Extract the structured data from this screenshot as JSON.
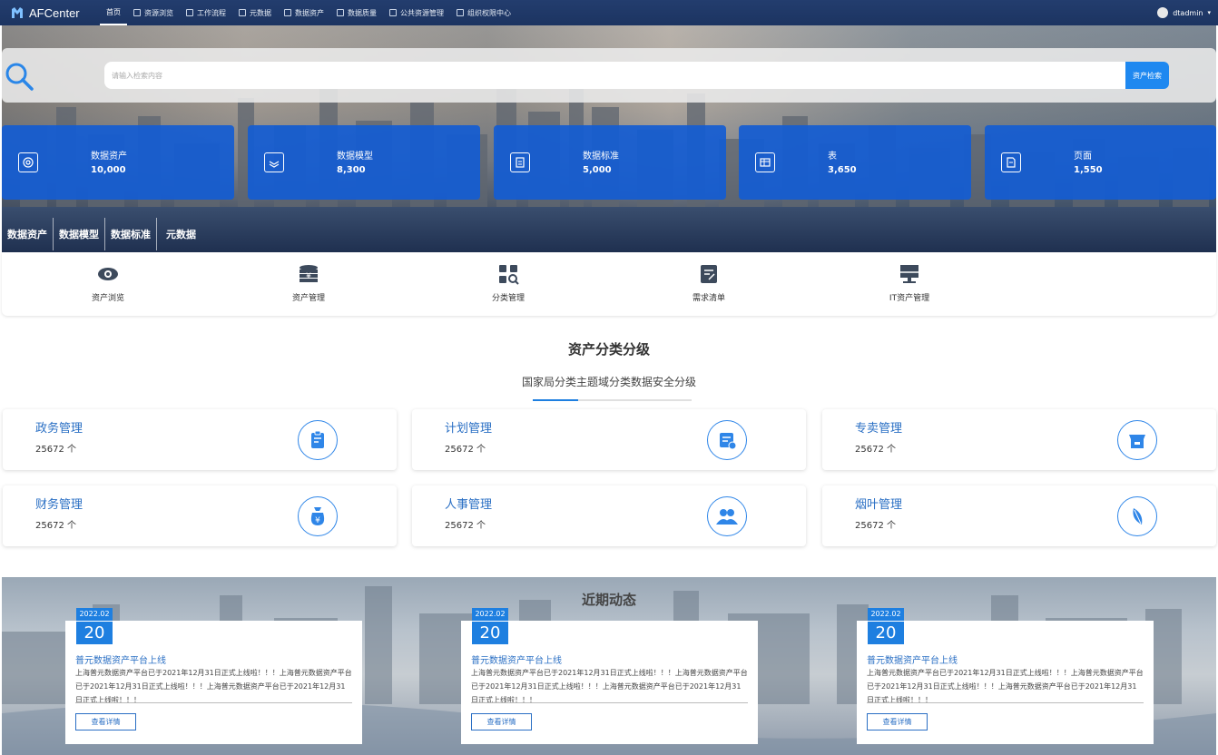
{
  "app": {
    "brand": "AFCenter"
  },
  "nav": {
    "items": [
      {
        "label": "首页",
        "active": true
      },
      {
        "label": "资源浏览"
      },
      {
        "label": "工作流程"
      },
      {
        "label": "元数据"
      },
      {
        "label": "数据资产"
      },
      {
        "label": "数据质量"
      },
      {
        "label": "公共资源管理"
      },
      {
        "label": "组织权限中心"
      }
    ],
    "user": "dtadmin"
  },
  "search": {
    "placeholder": "请输入检索内容",
    "button": "资产检索"
  },
  "stats": [
    {
      "label": "数据资产",
      "value": "10,000",
      "icon": "asset-icon"
    },
    {
      "label": "数据模型",
      "value": "8,300",
      "icon": "model-icon"
    },
    {
      "label": "数据标准",
      "value": "5,000",
      "icon": "standard-icon"
    },
    {
      "label": "表",
      "value": "3,650",
      "icon": "table-icon"
    },
    {
      "label": "页面",
      "value": "1,550",
      "icon": "page-icon"
    }
  ],
  "hero_tabs": [
    "数据资产",
    "数据模型",
    "数据标准",
    "元数据"
  ],
  "quick_menu": [
    {
      "label": "资产浏览",
      "icon": "eye-icon"
    },
    {
      "label": "资产管理",
      "icon": "coins-icon"
    },
    {
      "label": "分类管理",
      "icon": "category-search-icon"
    },
    {
      "label": "需求清单",
      "icon": "request-list-icon"
    },
    {
      "label": "IT资产管理",
      "icon": "monitor-icon"
    }
  ],
  "section": {
    "title": "资产分类分级",
    "subtitle": "国家局分类主题域分类数据安全分级"
  },
  "categories": [
    {
      "name": "政务管理",
      "count": "25672 个",
      "icon": "clipboard-icon"
    },
    {
      "name": "计划管理",
      "count": "25672 个",
      "icon": "plan-icon"
    },
    {
      "name": "专卖管理",
      "count": "25672 个",
      "icon": "store-icon"
    },
    {
      "name": "财务管理",
      "count": "25672 个",
      "icon": "money-bag-icon"
    },
    {
      "name": "人事管理",
      "count": "25672 个",
      "icon": "people-icon"
    },
    {
      "name": "烟叶管理",
      "count": "25672 个",
      "icon": "leaf-icon"
    }
  ],
  "news": {
    "title": "近期动态",
    "items": [
      {
        "month": "2022.02",
        "day": "20",
        "headline": "普元数据资产平台上线",
        "body": "上海普元数据资产平台已于2021年12月31日正式上线啦！！！上海普元数据资产平台已于2021年12月31日正式上线啦！！！上海普元数据资产平台已于2021年12月31日正式上线啦！！！",
        "button": "查看详情"
      },
      {
        "month": "2022.02",
        "day": "20",
        "headline": "普元数据资产平台上线",
        "body": "上海普元数据资产平台已于2021年12月31日正式上线啦！！！上海普元数据资产平台已于2021年12月31日正式上线啦！！！上海普元数据资产平台已于2021年12月31日正式上线啦！！！",
        "button": "查看详情"
      },
      {
        "month": "2022.02",
        "day": "20",
        "headline": "普元数据资产平台上线",
        "body": "上海普元数据资产平台已于2021年12月31日正式上线啦！！！上海普元数据资产平台已于2021年12月31日正式上线啦！！！上海普元数据资产平台已于2021年12月31日正式上线啦！！！",
        "button": "查看详情"
      }
    ]
  },
  "colors": {
    "nav_bg": "#1c3461",
    "accent": "#1e88f0",
    "stat_card": "#145cd2",
    "category_text": "#2a6fc4"
  }
}
